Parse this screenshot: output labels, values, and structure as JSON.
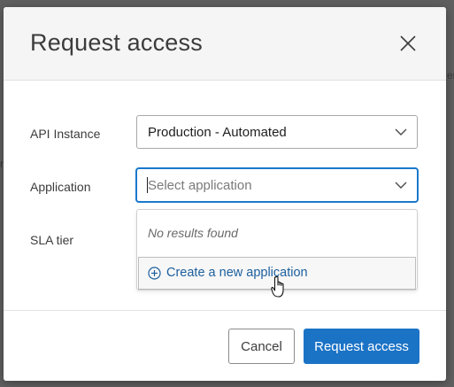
{
  "dialog": {
    "title": "Request access"
  },
  "form": {
    "api_instance": {
      "label": "API Instance",
      "value": "Production - Automated"
    },
    "application": {
      "label": "Application",
      "placeholder": "Select application"
    },
    "sla_tier": {
      "label": "SLA tier"
    }
  },
  "dropdown": {
    "empty_message": "No results found",
    "create_option": "Create a new application"
  },
  "footer": {
    "cancel_label": "Cancel",
    "submit_label": "Request access"
  },
  "colors": {
    "primary": "#1b73c6",
    "focus_border": "#1a78cc",
    "link": "#1c5f9e",
    "header_bg": "#f5f5f5",
    "overlay": "#5f5f5f"
  },
  "icons": {
    "close": "close-icon",
    "chevron": "chevron-down-icon",
    "create": "plus-circle-icon",
    "pointer": "hand-pointer-cursor"
  }
}
